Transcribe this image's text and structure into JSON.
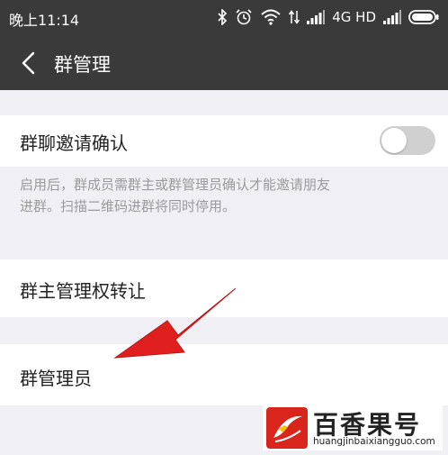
{
  "status_bar": {
    "time": "晚上11:14",
    "network": "4G HD",
    "icons": [
      "bluetooth-icon",
      "alarm-icon",
      "wifi-icon",
      "data-arrows-icon",
      "signal-icon",
      "signal-icon",
      "battery-icon"
    ]
  },
  "nav": {
    "back_icon": "chevron-left-icon",
    "title": "群管理"
  },
  "settings": {
    "invite_confirm": {
      "label": "群聊邀请确认",
      "toggle_on": false,
      "description_line1": "启用后，群成员需群主或群管理员确认才能邀请朋友",
      "description_line2": "进群。扫描二维码进群将同时停用。"
    },
    "transfer_owner": {
      "label": "群主管理权转让"
    },
    "group_admins": {
      "label": "群管理员"
    }
  },
  "annotation": {
    "color": "#e0201e"
  },
  "watermark": {
    "title": "百香果号",
    "url": "huangjinbaixiangguo.com"
  },
  "colors": {
    "header_bg": "#3a3a3a",
    "page_bg": "#efeff4",
    "toggle_off": "#d0d0d0",
    "brand_red": "#d9261c"
  }
}
